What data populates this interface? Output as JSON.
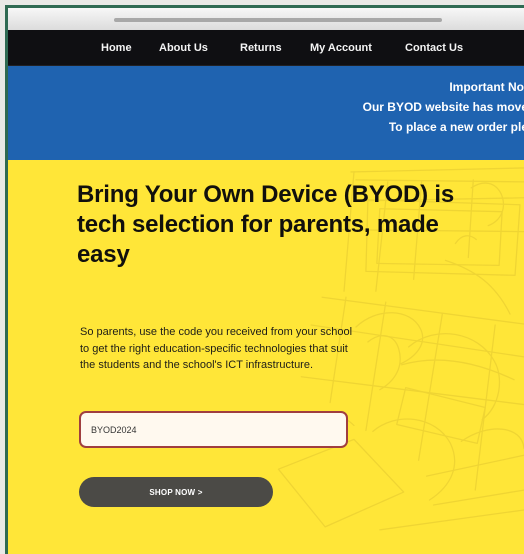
{
  "nav": {
    "items": [
      "Home",
      "About Us",
      "Returns",
      "My Account",
      "Contact Us"
    ]
  },
  "notice": {
    "title": "Important Not",
    "line1": "Our BYOD website has move",
    "line2": "To place a new order ple"
  },
  "hero": {
    "headline": "Bring Your Own Device (BYOD) is tech selection for parents, made easy",
    "intro": "So parents, use the code you received from your school to get the right education-specific technologies that suit the students and the school's ICT infrastructure.",
    "code_value": "BYOD2024",
    "shop_button": "SHOP NOW >"
  },
  "colors": {
    "hero_yellow": "#ffe638",
    "notice_blue": "#1f63b0",
    "nav_black": "#0f0f12",
    "button_gray": "#4b4a46",
    "input_border": "#a03f3f"
  },
  "icons": {
    "caret": "text-cursor"
  }
}
